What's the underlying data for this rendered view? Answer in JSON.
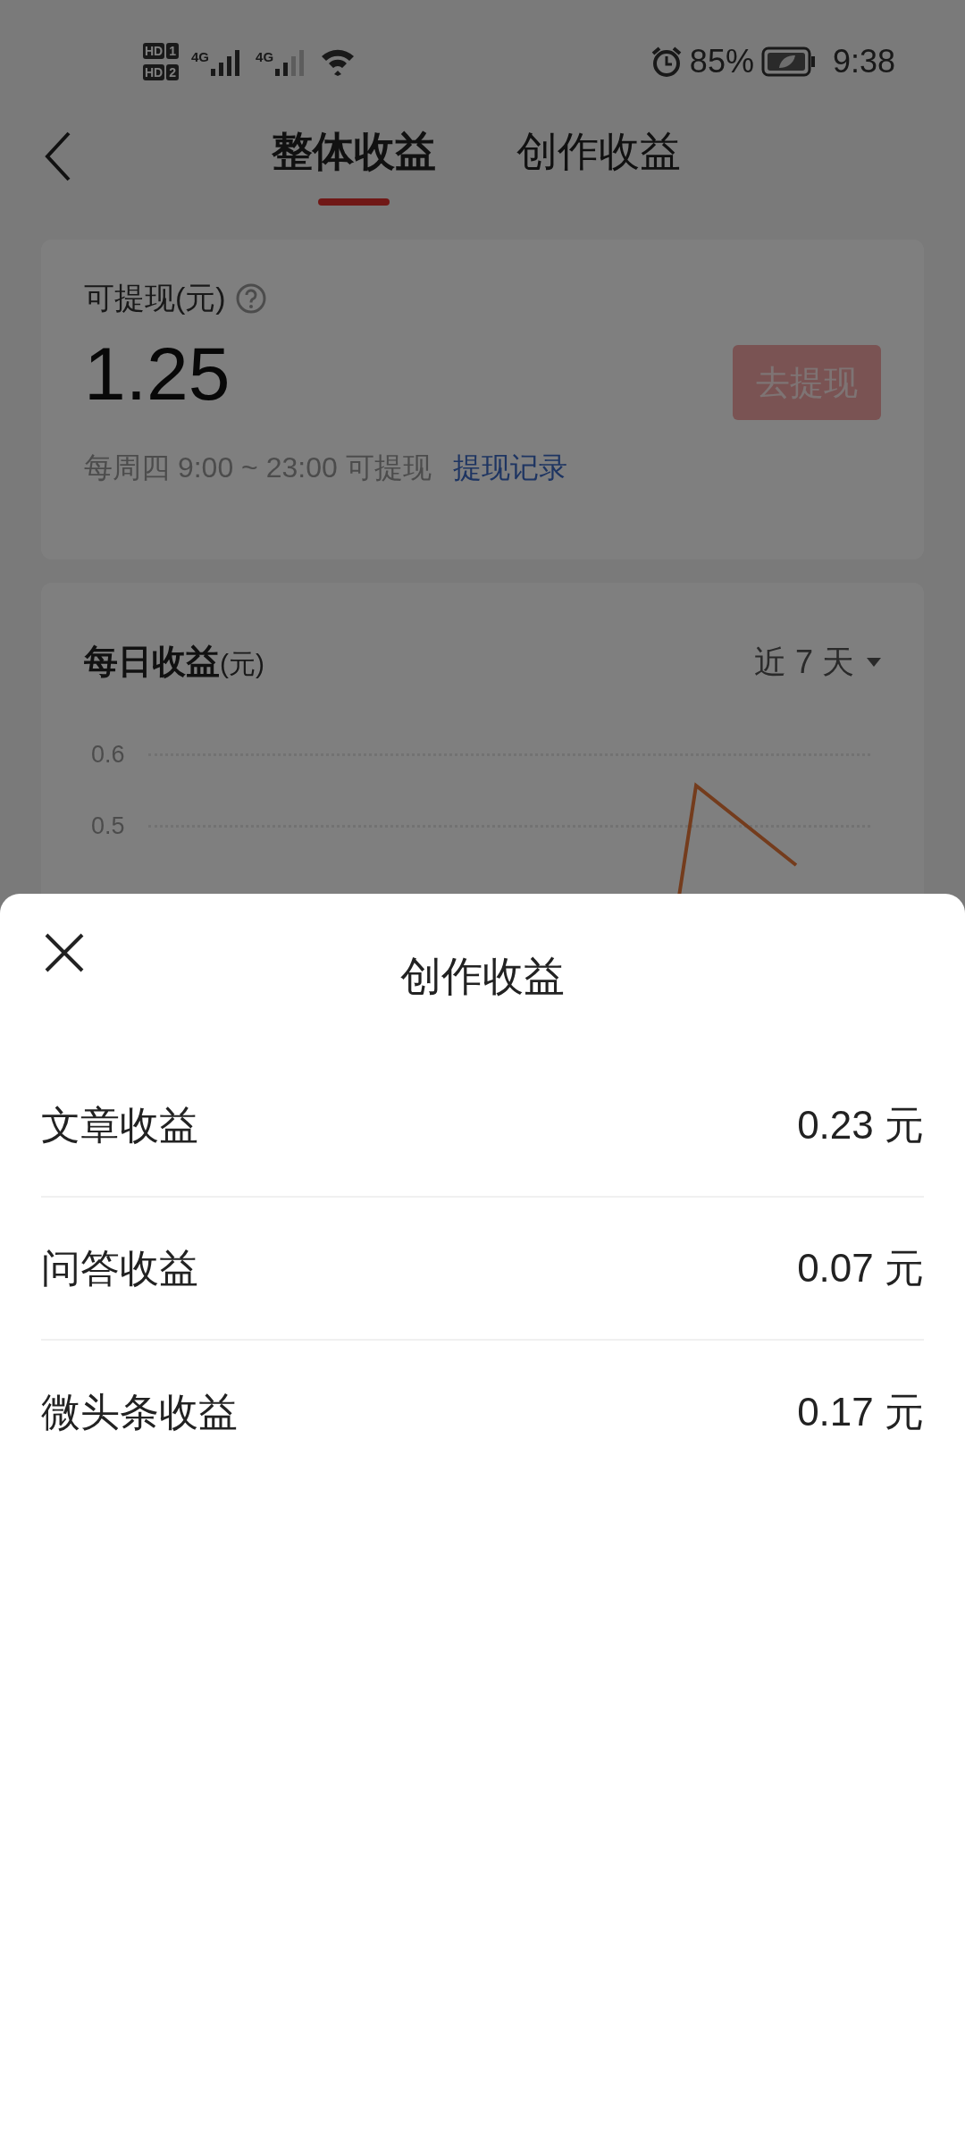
{
  "status_bar": {
    "hd_badges": [
      {
        "hd": "HD",
        "sim": "1"
      },
      {
        "hd": "HD",
        "sim": "2"
      }
    ],
    "network_labels": [
      "4G",
      "4G"
    ],
    "battery": "85%",
    "time": "9:38"
  },
  "tabs": [
    {
      "label": "整体收益",
      "selected": true
    },
    {
      "label": "创作收益",
      "selected": false
    }
  ],
  "withdraw_card": {
    "label": "可提现(元)",
    "amount": "1.25",
    "button": {
      "label": "去提现",
      "disabled": true
    },
    "schedule": "每周四 9:00 ~ 23:00 可提现",
    "link": "提现记录"
  },
  "daily_card": {
    "title": "每日收益",
    "unit": "(元)",
    "range": "近 7 天",
    "axis_labels": [
      "0.6",
      "0.5"
    ]
  },
  "sheet": {
    "title": "创作收益",
    "rows": [
      {
        "label": "文章收益",
        "value": "0.23 元"
      },
      {
        "label": "问答收益",
        "value": "0.07 元"
      },
      {
        "label": "微头条收益",
        "value": "0.17 元"
      }
    ]
  }
}
